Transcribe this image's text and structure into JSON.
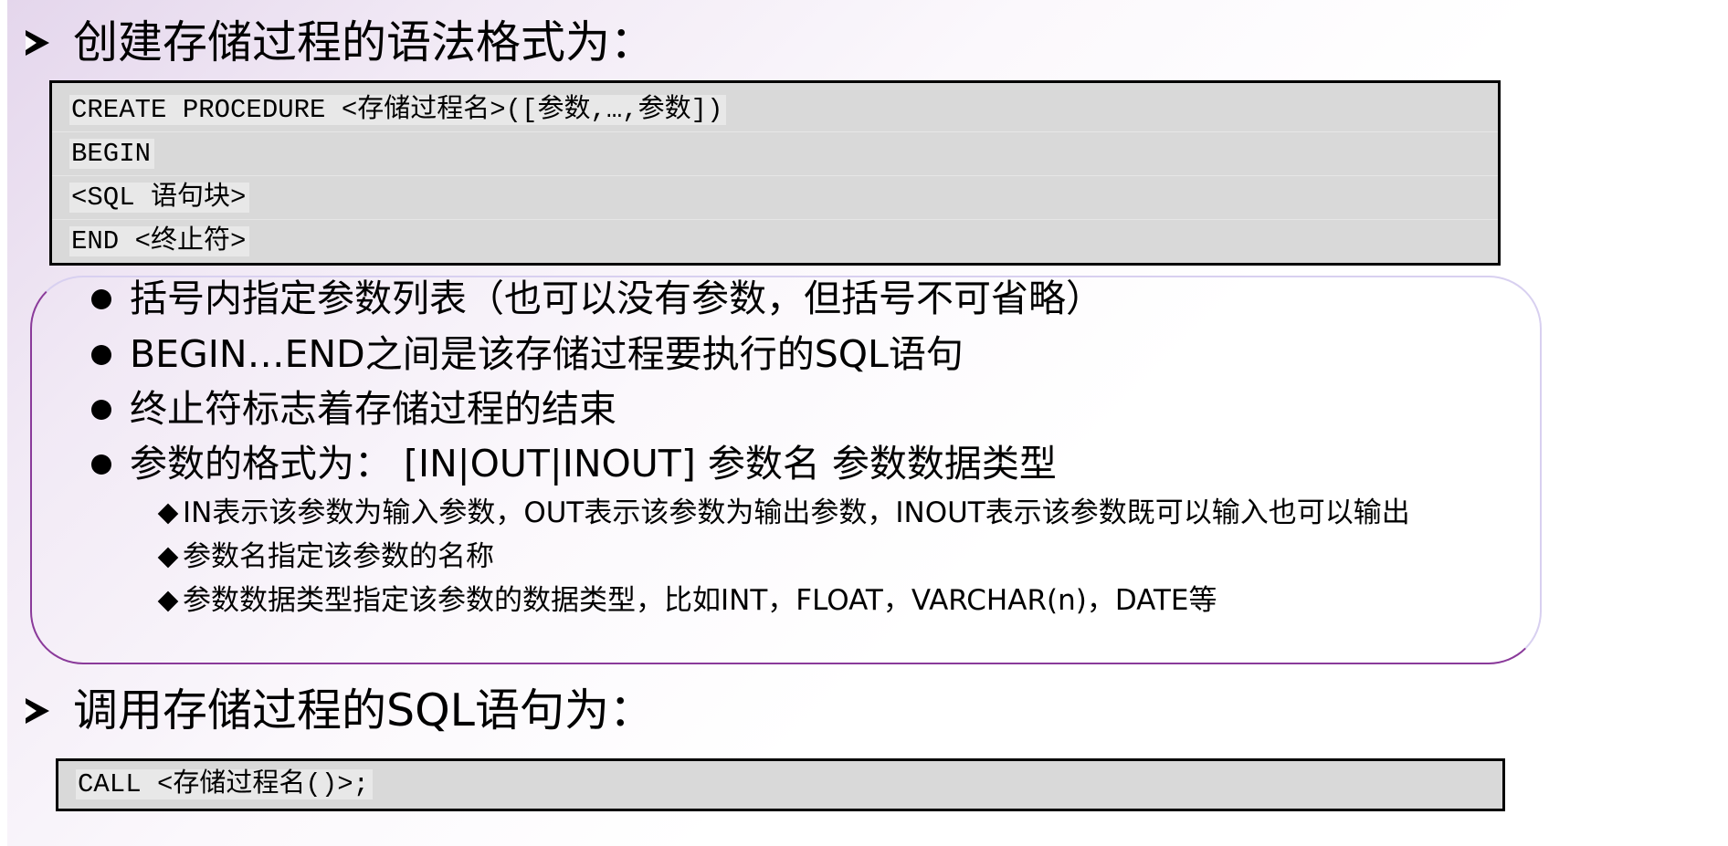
{
  "slide": {
    "heading_create": "创建存储过程的语法格式为：",
    "syntax_lines": [
      "CREATE PROCEDURE <存储过程名>([参数,…,参数])",
      "BEGIN",
      "<SQL 语句块>",
      "END <终止符>"
    ],
    "bullets": [
      "括号内指定参数列表（也可以没有参数，但括号不可省略）",
      "BEGIN…END之间是该存储过程要执行的SQL语句",
      "终止符标志着存储过程的结束",
      "参数的格式为： [IN|OUT|INOUT] 参数名 参数数据类型"
    ],
    "sub_bullets": [
      "IN表示该参数为输入参数，OUT表示该参数为输出参数，INOUT表示该参数既可以输入也可以输出",
      "参数名指定该参数的名称",
      "参数数据类型指定该参数的数据类型，比如INT，FLOAT，VARCHAR(n)，DATE等"
    ],
    "heading_call": "调用存储过程的SQL语句为：",
    "call_line": "CALL <存储过程名()>;"
  },
  "colors": {
    "code_background": "#d9d9d9",
    "box_border_accent": "#8a3a9a",
    "background_tint": "#e4d6ec"
  },
  "icons": {
    "heading_marker": "arrow-right-icon",
    "bullet_marker": "filled-circle-icon",
    "sub_bullet_marker": "diamond-icon"
  }
}
